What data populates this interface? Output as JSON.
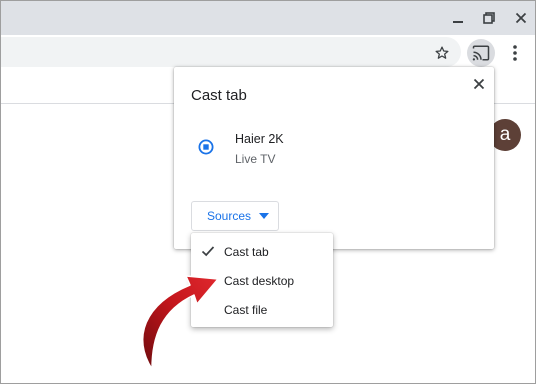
{
  "window": {
    "minimize_icon": "minimize-icon",
    "maximize_icon": "restore-icon",
    "close_icon": "close-icon"
  },
  "toolbar": {
    "bookmark_icon": "star-icon",
    "cast_icon": "cast-icon",
    "menu_icon": "more-vertical-icon"
  },
  "profile": {
    "avatar_letter": "a",
    "avatar_color": "#5d4037"
  },
  "cast_dialog": {
    "title": "Cast tab",
    "sink": {
      "name": "Haier 2K",
      "status": "Live TV"
    },
    "sources_label": "Sources",
    "accent_color": "#1a73e8"
  },
  "sources_menu": {
    "items": [
      {
        "label": "Cast tab",
        "checked": true
      },
      {
        "label": "Cast desktop",
        "checked": false
      },
      {
        "label": "Cast file",
        "checked": false
      }
    ]
  },
  "annotation": {
    "arrow_color": "#c4161c"
  }
}
